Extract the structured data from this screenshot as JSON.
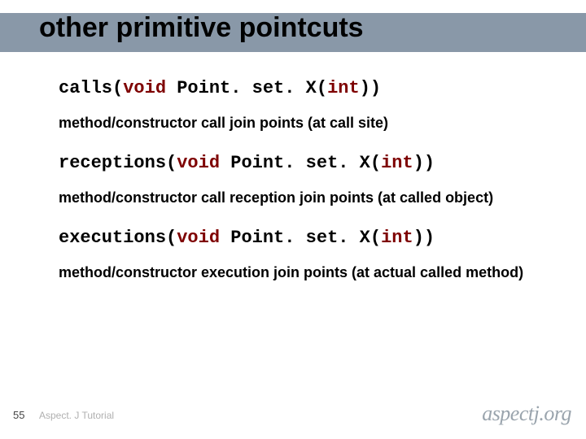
{
  "title": "other primitive pointcuts",
  "lines": [
    {
      "prefix": "calls(",
      "kw1": "void",
      "mid": " Point. set. X(",
      "kw2": "int",
      "suffix": "))"
    },
    {
      "desc": "method/constructor call join points (at call site)"
    },
    {
      "prefix": "receptions(",
      "kw1": "void",
      "mid": " Point. set. X(",
      "kw2": "int",
      "suffix": "))"
    },
    {
      "desc": "method/constructor call reception join points (at called object)"
    },
    {
      "prefix": "executions(",
      "kw1": "void",
      "mid": " Point. set. X(",
      "kw2": "int",
      "suffix": "))"
    },
    {
      "desc": "method/constructor execution join points (at actual called method)"
    }
  ],
  "footer": {
    "page": "55",
    "tutorial": "Aspect. J Tutorial",
    "logo_main": "aspect",
    "logo_j": "j",
    "logo_suffix": ".org"
  }
}
